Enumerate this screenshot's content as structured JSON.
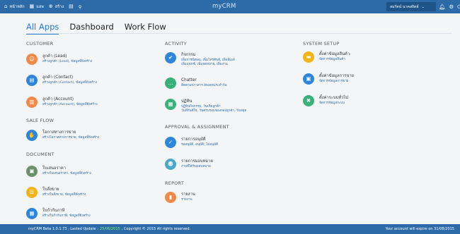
{
  "topbar": {
    "home": "หน้าหลัก",
    "apps": "แอพ",
    "create": "สร้าง",
    "brand": "myCRM",
    "user": "สมรัตน์ นาคสถิตย์"
  },
  "tabs": [
    "All Apps",
    "Dashboard",
    "Work Flow"
  ],
  "sections": {
    "customer": "CUSTOMER",
    "saleflow": "SALE FLOW",
    "document": "DOCUMENT",
    "activity": "ACTIVITY",
    "approval": "APPROVAL & ASSIGNMENT",
    "report": "REPORT",
    "system": "SYSTEM SETUP"
  },
  "items": {
    "lead": {
      "title": "ลูกค้า (Lead)",
      "sub": "สร้างลูกค้า (Lead), ข้อมูลที่ยังสร้าง",
      "color": "#f08a4b"
    },
    "contact": {
      "title": "ลูกค้า (Contact)",
      "sub": "สร้างลูกค้า (Contact), ข้อมูลที่ยังสร้าง",
      "color": "#2f86d8"
    },
    "account": {
      "title": "ลูกค้า (Account)",
      "sub": "สร้างลูกค้า (Account), ข้อมูลที่ยังสร้าง",
      "color": "#f08a4b"
    },
    "opportunity": {
      "title": "โอกาสทางการขาย",
      "sub": "สร้างโอกาสทางการขาย, ข้อมูลที่ยังสร้าง",
      "color": "#2f86d8"
    },
    "quotation": {
      "title": "ใบเสนอราคา",
      "sub": "สร้างใบเสนอราคา, ข้อมูลที่ยังสร้าง",
      "color": "#6b8f6b"
    },
    "salesorder": {
      "title": "ใบสั่งขาย",
      "sub": "สร้างใบสั่งขาย, ข้อมูลที่ยังสร้าง",
      "color": "#f2b41b"
    },
    "invoice": {
      "title": "ใบกำกับภาษี",
      "sub": "สร้างใบกำกับภาษี, ข้อมูลที่ยังสร้าง",
      "color": "#2f86d8"
    },
    "activity": {
      "title": "กิจกรรม",
      "sub1": "เพิ่มการนัดพบ, เพิ่มโทรศัพท์, เพิ่มอีเมล์",
      "sub2": "เพิ่มแฟกซ์, เพิ่มจดหมาย, เพิ่มงาน",
      "color": "#2f86d8"
    },
    "chatter": {
      "title": "Chatter",
      "sub": "ติดตามข่าวสาร อัพเดทประจำวัน",
      "color": "#3ab07a"
    },
    "calendar": {
      "title": "ปฏิทิน",
      "sub1": "ปฏิทินกิจกรรม, วันเกิดลูกค้า",
      "sub2": "วันที่กันต์ใจ, วันครบรอบของกองลูกค้า, วันหยุด",
      "color": "#3ab07a"
    },
    "approve": {
      "title": "รายการอนุมัติ",
      "sub": "รออนุมัติ, อนุมัติ, ไม่อนุมัติ",
      "color": "#2f86d8"
    },
    "assign": {
      "title": "รายการมอบหมาย",
      "sub": "งานที่ได้รับมอบหมาย",
      "color": "#4aa8c8"
    },
    "report": {
      "title": "รายงาน",
      "sub": "รายงาน",
      "color": "#f08a4b"
    },
    "product": {
      "title": "ตั้งค่าข้อมูลสินค้า",
      "sub": "จัดการข้อมูลสินค้า",
      "color": "#f2b41b"
    },
    "salesdata": {
      "title": "ตั้งค่าข้อมูลการขาย",
      "sub": "จัดการข้อมูลการขาย",
      "color": "#2f86d8"
    },
    "general": {
      "title": "ตั้งค่าระบบทั่วไป",
      "sub": "จัดการข้อมูลระบบ",
      "color": "#3ab07a"
    }
  },
  "footer": {
    "prefix": "myCRM Beta 1.0.1.73 , Lasted Update :",
    "date": "25/06/2015",
    "copyright": ", Copyright © 2015 All rights reserved.",
    "expire": "Your account will expire on 31/08/2015"
  }
}
